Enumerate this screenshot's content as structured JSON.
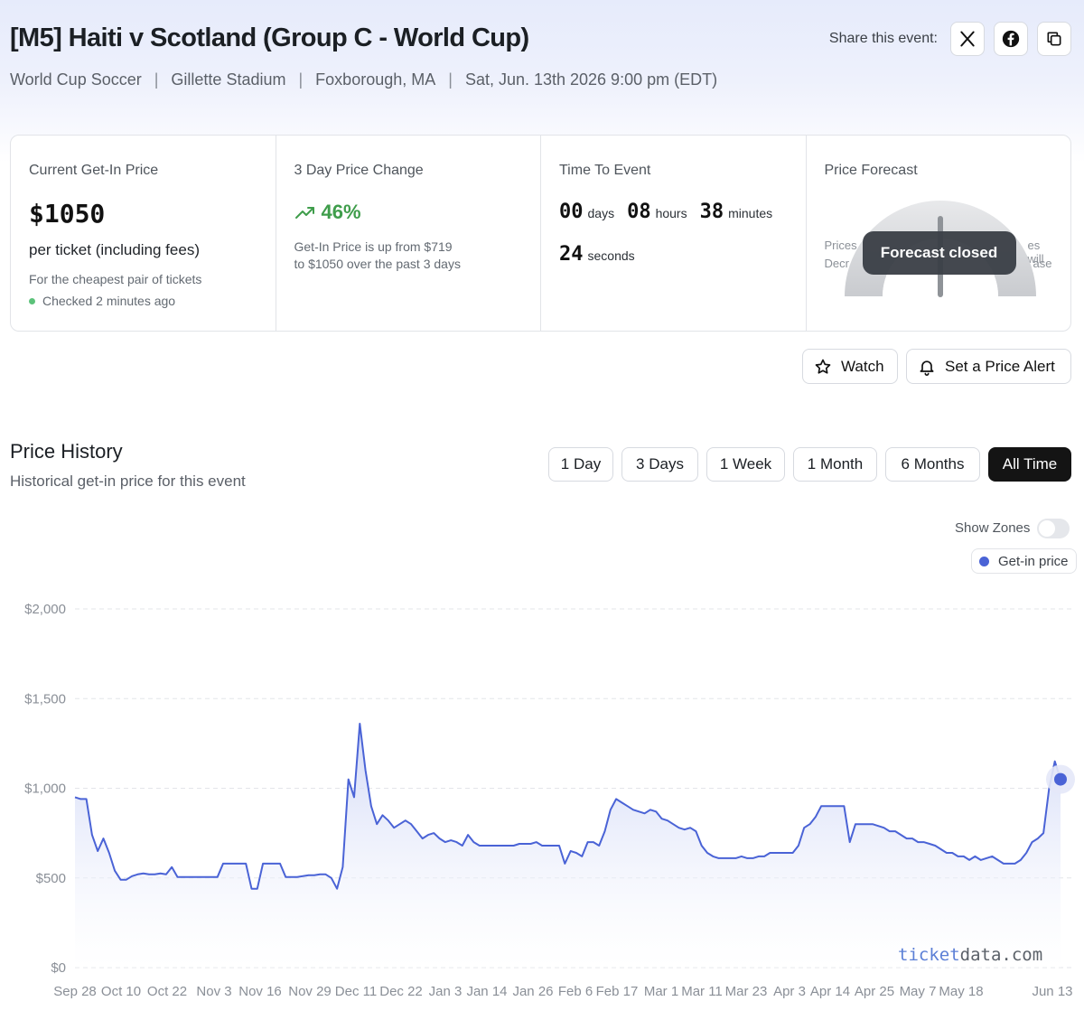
{
  "header": {
    "title": "[M5] Haiti v Scotland (Group C - World Cup)",
    "meta": [
      "World Cup Soccer",
      "Gillette Stadium",
      "Foxborough, MA",
      "Sat, Jun. 13th 2026 9:00 pm (EDT)"
    ],
    "share_label": "Share this event:",
    "share_buttons": [
      "x-icon",
      "facebook-icon",
      "copy-icon"
    ]
  },
  "stats": {
    "current": {
      "title": "Current Get-In Price",
      "price": "$1050",
      "per_ticket": "per ticket (including fees)",
      "note": "For the cheapest pair of tickets",
      "checked": "Checked 2 minutes ago"
    },
    "change": {
      "title": "3 Day Price Change",
      "percent": "46%",
      "desc_line1": "Get-In Price is up from $719",
      "desc_line2": "to $1050 over the past 3 days"
    },
    "time": {
      "title": "Time To Event",
      "days": "00",
      "days_unit": "days",
      "hours": "08",
      "hours_unit": "hours",
      "minutes": "38",
      "minutes_unit": "minutes",
      "seconds": "24",
      "seconds_unit": "seconds"
    },
    "forecast": {
      "title": "Price Forecast",
      "left_line1": "Prices",
      "left_line2": "Decr",
      "right_line1": "es will",
      "right_line2": "ase",
      "status": "Forecast closed"
    }
  },
  "actions": {
    "watch": "Watch",
    "alert": "Set a Price Alert"
  },
  "history": {
    "title": "Price History",
    "subtitle": "Historical get-in price for this event",
    "ranges": [
      "1 Day",
      "3 Days",
      "1 Week",
      "1 Month",
      "6 Months",
      "All Time"
    ],
    "active_range": "All Time",
    "show_zones": "Show Zones",
    "zones_on": false
  },
  "watermark": {
    "a": "ticket",
    "b": "data.com"
  },
  "colors": {
    "line": "#4a63d6",
    "positive": "#3f9d4b",
    "active_btn": "#141414"
  },
  "chart_data": {
    "type": "line",
    "series": [
      {
        "name": "Get-in price",
        "values": [
          950,
          940,
          940,
          740,
          650,
          720,
          640,
          540,
          490,
          490,
          510,
          520,
          525,
          520,
          520,
          525,
          520,
          560,
          505,
          505,
          505,
          505,
          505,
          505,
          505,
          505,
          580,
          580,
          580,
          580,
          580,
          440,
          440,
          580,
          580,
          580,
          580,
          505,
          505,
          505,
          510,
          515,
          515,
          520,
          520,
          500,
          440,
          560,
          1050,
          950,
          1360,
          1100,
          900,
          800,
          850,
          820,
          780,
          800,
          820,
          800,
          760,
          720,
          740,
          750,
          720,
          700,
          710,
          700,
          680,
          740,
          700,
          680,
          680,
          680,
          680,
          680,
          680,
          680,
          690,
          690,
          690,
          700,
          680,
          680,
          680,
          680,
          580,
          650,
          640,
          620,
          700,
          700,
          680,
          760,
          880,
          940,
          920,
          900,
          880,
          870,
          860,
          880,
          870,
          830,
          820,
          800,
          780,
          770,
          780,
          760,
          680,
          640,
          620,
          610,
          610,
          610,
          610,
          620,
          610,
          610,
          620,
          620,
          640,
          640,
          640,
          640,
          640,
          680,
          780,
          800,
          840,
          900,
          900,
          900,
          900,
          900,
          700,
          800,
          800,
          800,
          800,
          790,
          780,
          760,
          760,
          740,
          720,
          720,
          700,
          700,
          690,
          680,
          660,
          640,
          640,
          620,
          620,
          600,
          620,
          600,
          610,
          620,
          600,
          580,
          580,
          580,
          600,
          640,
          700,
          720,
          750,
          1000,
          1150,
          1050
        ]
      }
    ],
    "x_ticks": [
      "Sep 28",
      "Oct 10",
      "Oct 22",
      "Nov 3",
      "Nov 16",
      "Nov 29",
      "Dec 11",
      "Dec 22",
      "Jan 3",
      "Jan 14",
      "Jan 26",
      "Feb 6",
      "Feb 17",
      "Mar 1",
      "Mar 11",
      "Mar 23",
      "Apr 3",
      "Apr 14",
      "Apr 25",
      "May 7",
      "May 18",
      "Jun 13"
    ],
    "y_ticks": [
      "$0",
      "$500",
      "$1,000",
      "$1,500",
      "$2,000"
    ],
    "y_tick_values": [
      0,
      500,
      1000,
      1500,
      2000
    ],
    "ylim": [
      0,
      2000
    ],
    "last_value": 1050,
    "grid": true,
    "legend": "top-right"
  }
}
